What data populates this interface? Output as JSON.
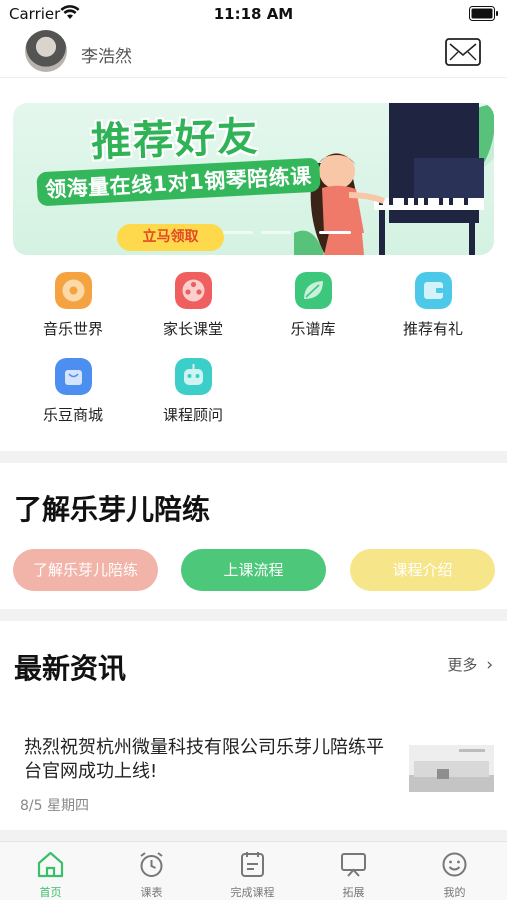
{
  "status_bar": {
    "carrier": "Carrier",
    "time": "11:18 AM"
  },
  "header": {
    "username": "李浩然",
    "avatar_icon": "user-avatar",
    "mail_icon": "envelope-icon"
  },
  "banner": {
    "title": "推荐好友",
    "subtitle": "领海量在线1对1钢琴陪练课",
    "cta": "立马领取",
    "colors": {
      "green": "#2fb356",
      "cta_bg": "#ffd94c",
      "cta_text": "#e2492a"
    }
  },
  "menu": {
    "items": [
      {
        "label": "音乐世界",
        "icon": "vinyl-record-icon",
        "color": "#f5a341"
      },
      {
        "label": "家长课堂",
        "icon": "film-reel-icon",
        "color": "#f05f5f"
      },
      {
        "label": "乐谱库",
        "icon": "leaf-icon",
        "color": "#3cc77c"
      },
      {
        "label": "推荐有礼",
        "icon": "wallet-icon",
        "color": "#4cc9e8"
      },
      {
        "label": "乐豆商城",
        "icon": "shopping-bag-icon",
        "color": "#4d8ff0"
      },
      {
        "label": "课程顾问",
        "icon": "robot-icon",
        "color": "#3ccfc9"
      }
    ]
  },
  "about": {
    "heading": "了解乐芽儿陪练",
    "buttons": [
      {
        "label": "了解乐芽儿陪练",
        "color": "#f2b3a8"
      },
      {
        "label": "上课流程",
        "color": "#4dc779"
      },
      {
        "label": "课程介绍",
        "color": "#f7e58a"
      }
    ]
  },
  "news": {
    "heading": "最新资讯",
    "more": "更多",
    "items": [
      {
        "title": "热烈祝贺杭州微量科技有限公司乐芽儿陪练平台官网成功上线!",
        "date": "8/5 星期四"
      }
    ]
  },
  "tabbar": {
    "items": [
      {
        "label": "首页",
        "icon": "home-icon",
        "active": true
      },
      {
        "label": "课表",
        "icon": "alarm-clock-icon",
        "active": false
      },
      {
        "label": "完成课程",
        "icon": "checklist-icon",
        "active": false
      },
      {
        "label": "拓展",
        "icon": "monitor-icon",
        "active": false
      },
      {
        "label": "我的",
        "icon": "smiley-icon",
        "active": false
      }
    ],
    "active_color": "#3bbf6a"
  }
}
